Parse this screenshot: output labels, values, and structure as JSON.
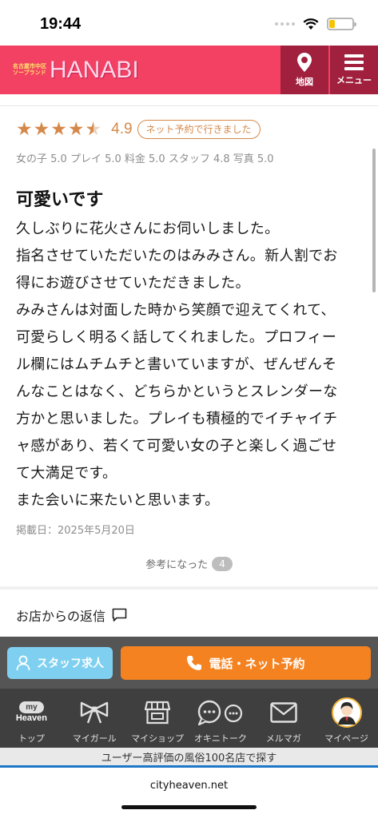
{
  "status_bar": {
    "time": "19:44"
  },
  "header": {
    "logo_small": [
      "名古屋市中区",
      "ソープランド"
    ],
    "logo_main": "HANABI",
    "map_label": "地図",
    "menu_label": "メニュー"
  },
  "review": {
    "rating_stars": 4.5,
    "score": "4.9",
    "badge": "ネット予約で行きました",
    "sub_scores": "女の子 5.0 プレイ 5.0 料金 5.0 スタッフ 4.8 写真 5.0",
    "title": "可愛いです",
    "body_lines": [
      "久しぶりに花火さんにお伺いしました。",
      "指名させていただいたのはみみさん。新人割でお",
      "得にお遊びさせていただきました。",
      "みみさんは対面した時から笑顔で迎えてくれて、",
      "可愛らしく明るく話してくれました。プロフィー",
      "ル欄にはムチムチと書いていますが、ぜんぜんそ",
      "んなことはなく、どちらかというとスレンダーな",
      "方かと思いました。プレイも積極的でイチャイチ",
      "ャ感があり、若くて可愛い女の子と楽しく過ごせ",
      "て大満足です。",
      "また会いに来たいと思います。"
    ],
    "posted": "掲載日：2025年5月20日",
    "helpful_label": "参考になった",
    "helpful_count": "4"
  },
  "reply": {
    "label": "お店からの返信"
  },
  "actions": {
    "staff_label": "スタッフ求人",
    "call_label": "電話・ネット予約"
  },
  "nav": {
    "items": [
      {
        "label": "トップ",
        "icon": "my-heaven-icon",
        "icon_text_1": "my",
        "icon_text_2": "Heaven"
      },
      {
        "label": "マイガール",
        "icon": "ribbon-icon"
      },
      {
        "label": "マイショップ",
        "icon": "shop-icon"
      },
      {
        "label": "オキニトーク",
        "icon": "chat-icon"
      },
      {
        "label": "メルマガ",
        "icon": "mail-icon"
      },
      {
        "label": "マイページ",
        "icon": "avatar-icon"
      }
    ]
  },
  "promo": {
    "text": "ユーザー高評価の風俗100名店で探す"
  },
  "url_bar": {
    "url": "cityheaven.net"
  },
  "colors": {
    "header": "#f34163",
    "header_button": "#a0203e",
    "accent": "#d4894a",
    "call": "#f58220",
    "staff": "#7fd0f0"
  }
}
